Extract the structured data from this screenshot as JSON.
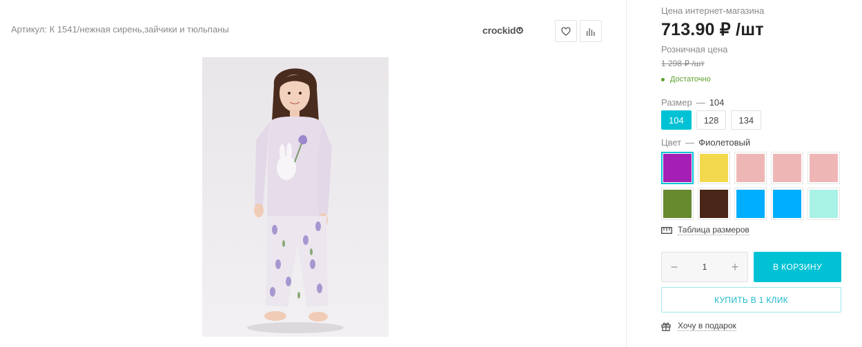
{
  "product": {
    "article": "Артикул: К 1541/нежная сирень,зайчики и тюльпаны",
    "brand": "crockid",
    "image_alt": "child in lilac pajamas with bunny print"
  },
  "pricing": {
    "online_label": "Цена интернет-магазина",
    "online_price": "713.90 ₽ /шт",
    "retail_label": "Розничная цена",
    "retail_price": "1 298 ₽ /шт",
    "stock": "Достаточно"
  },
  "size": {
    "label": "Размер",
    "dash": "—",
    "selected": "104",
    "options": [
      "104",
      "128",
      "134"
    ]
  },
  "color": {
    "label": "Цвет",
    "dash": "—",
    "selected": "Фиолетовый",
    "swatches": [
      "#a51fb5",
      "#f2d94e",
      "#efb6b6",
      "#efb6b6",
      "#efb6b6",
      "#678a2f",
      "#4a2619",
      "#00aeff",
      "#00aeff",
      "#a8f2e6"
    ]
  },
  "links": {
    "size_table": "Таблица размеров",
    "gift": "Хочу в подарок"
  },
  "purchase": {
    "quantity": "1",
    "minus": "−",
    "plus": "+",
    "cart": "В КОРЗИНУ",
    "one_click": "КУПИТЬ В 1 КЛИК"
  },
  "colors": {
    "accent": "#00c2d4",
    "in_stock": "#5aa02c"
  }
}
